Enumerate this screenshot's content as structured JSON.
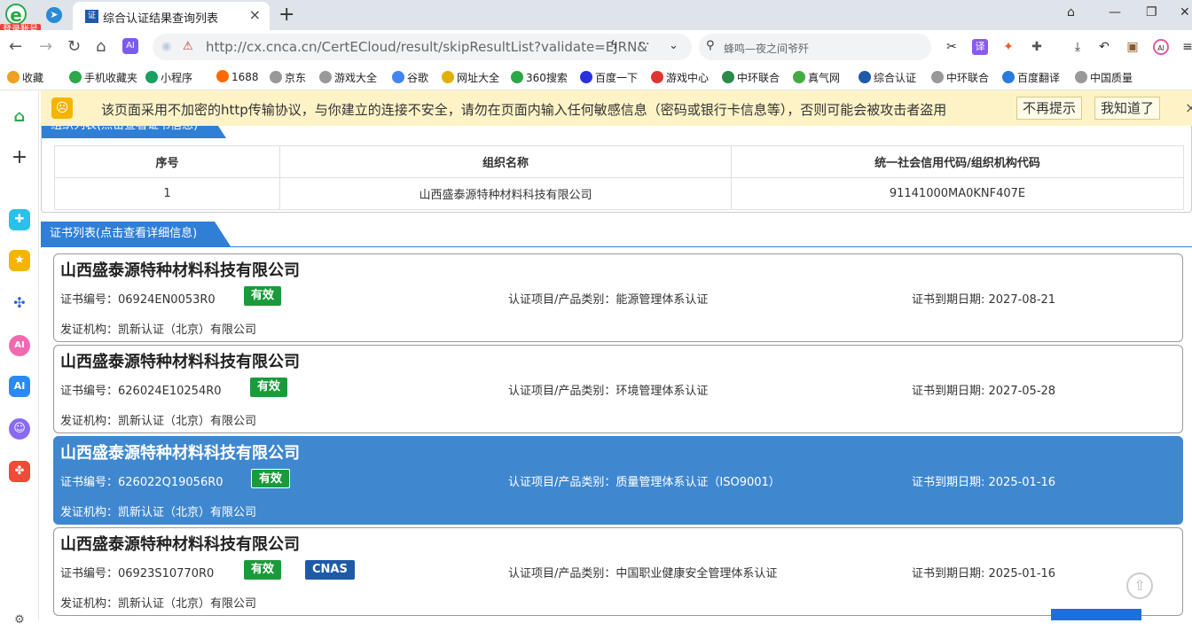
{
  "browser": {
    "login_badge": "登录账号",
    "tab_title": "综合认证结果查询列表",
    "tab_favicon": "证",
    "url": "http://cx.cnca.cn/CertECloud/result/skipResultList?validate=EJRN&",
    "search_placeholder": "蜂鸣—夜之间爷歼",
    "close_glyph": "×",
    "new_tab_glyph": "+"
  },
  "bookmarks": [
    {
      "label": "收藏",
      "icon": "star-icon",
      "color": "#f0a020"
    },
    {
      "label": "手机收藏夹",
      "icon": "phone-icon",
      "color": "#2aa84a"
    },
    {
      "label": "小程序",
      "icon": "miniapp-icon",
      "color": "#1aa060"
    },
    {
      "label": "1688",
      "icon": "shop-icon",
      "color": "#ff6a00"
    },
    {
      "label": "京东",
      "icon": "globe-icon",
      "color": "#999999"
    },
    {
      "label": "游戏大全",
      "icon": "globe-icon",
      "color": "#999999"
    },
    {
      "label": "谷歌",
      "icon": "google-icon",
      "color": "#4285f4"
    },
    {
      "label": "网址大全",
      "icon": "site-icon",
      "color": "#e0b000"
    },
    {
      "label": "360搜索",
      "icon": "search360-icon",
      "color": "#2aa84a"
    },
    {
      "label": "百度一下",
      "icon": "baidu-icon",
      "color": "#2932e1"
    },
    {
      "label": "游戏中心",
      "icon": "game-icon",
      "color": "#e23333"
    },
    {
      "label": "中环联合",
      "icon": "globe-icon",
      "color": "#2a8a4a"
    },
    {
      "label": "真气网",
      "icon": "leaf-icon",
      "color": "#44aa44"
    },
    {
      "label": "综合认证",
      "icon": "cert-icon",
      "color": "#1d5aa8"
    },
    {
      "label": "中环联合",
      "icon": "globe-icon",
      "color": "#999999"
    },
    {
      "label": "百度翻译",
      "icon": "translate-icon",
      "color": "#2a7ae0"
    },
    {
      "label": "中国质量",
      "icon": "globe-icon",
      "color": "#999999"
    }
  ],
  "warning": {
    "text": "该页面采用不加密的http传输协议，与你建立的连接不安全，请勿在页面内输入任何敏感信息（密码或银行卡信息等），否则可能会被攻击者盗用",
    "no_remind": "不再提示",
    "got_it": "我知道了"
  },
  "org_section": {
    "tab_label": "组织列表(点击查看证书信息)",
    "headers": [
      "序号",
      "组织名称",
      "统一社会信用代码/组织机构代码"
    ],
    "rows": [
      {
        "index": "1",
        "name": "山西盛泰源特种材料科技有限公司",
        "code": "91141000MA0KNF407E"
      }
    ]
  },
  "cert_section": {
    "tab_label": "证书列表(点击查看详细信息)",
    "no_label": "证书编号：",
    "project_label": "认证项目/产品类别：",
    "expiry_label": "证书到期日期: ",
    "issuer_label": "发证机构：",
    "cards": [
      {
        "org": "山西盛泰源特种材料科技有限公司",
        "cert_no": "06924EN0053R0",
        "status": "有效",
        "cnas": "",
        "project": "能源管理体系认证",
        "expiry": "2027-08-21",
        "issuer": "凯新认证（北京）有限公司"
      },
      {
        "org": "山西盛泰源特种材料科技有限公司",
        "cert_no": "626024E10254R0",
        "status": "有效",
        "cnas": "",
        "project": "环境管理体系认证",
        "expiry": "2027-05-28",
        "issuer": "凯新认证（北京）有限公司"
      },
      {
        "org": "山西盛泰源特种材料科技有限公司",
        "cert_no": "626022Q19056R0",
        "status": "有效",
        "cnas": "",
        "project": "质量管理体系认证（ISO9001）",
        "expiry": "2025-01-16",
        "issuer": "凯新认证（北京）有限公司"
      },
      {
        "org": "山西盛泰源特种材料科技有限公司",
        "cert_no": "06923S10770R0",
        "status": "有效",
        "cnas": "CNAS",
        "project": "中国职业健康安全管理体系认证",
        "expiry": "2025-01-16",
        "issuer": "凯新认证（北京）有限公司"
      }
    ]
  }
}
